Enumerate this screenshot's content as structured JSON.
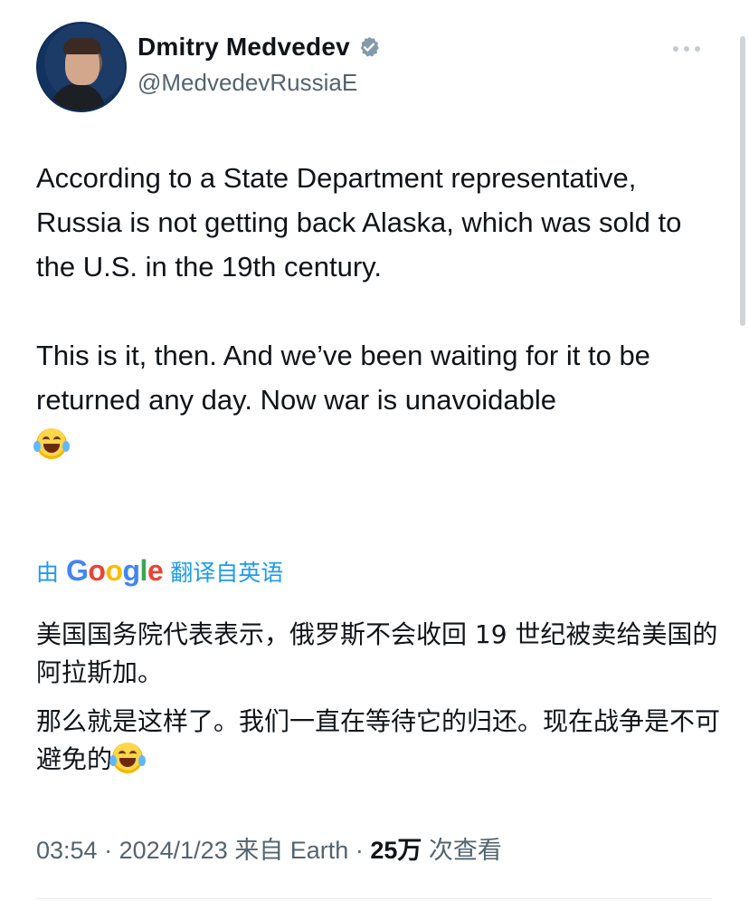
{
  "author": {
    "display_name": "Dmitry Medvedev",
    "handle": "@MedvedevRussiaE",
    "verified": true
  },
  "tweet": {
    "paragraph1": "According to a State Department representative, Russia is not getting back Alaska, which was sold to the U.S. in the 19th century.",
    "paragraph2": "This is it, then. And we’ve been waiting for it to be returned any day. Now war is unavoidable",
    "emoji": "face-with-tears-of-joy"
  },
  "translation": {
    "prefix": "由",
    "provider": "Google",
    "suffix": "翻译自英语",
    "paragraph1": "美国国务院代表表示，俄罗斯不会收回 19 世纪被卖给美国的阿拉斯加。",
    "paragraph2": "那么就是这样了。我们一直在等待它的归还。现在战争是不可避免的"
  },
  "meta": {
    "time": "03:54",
    "date": "2024/1/23",
    "source_prefix": "来自",
    "source": "Earth",
    "views_count": "25万",
    "views_label": "次查看"
  },
  "colors": {
    "text": "#0f1419",
    "secondary": "#536471",
    "link": "#1d9bf0"
  }
}
